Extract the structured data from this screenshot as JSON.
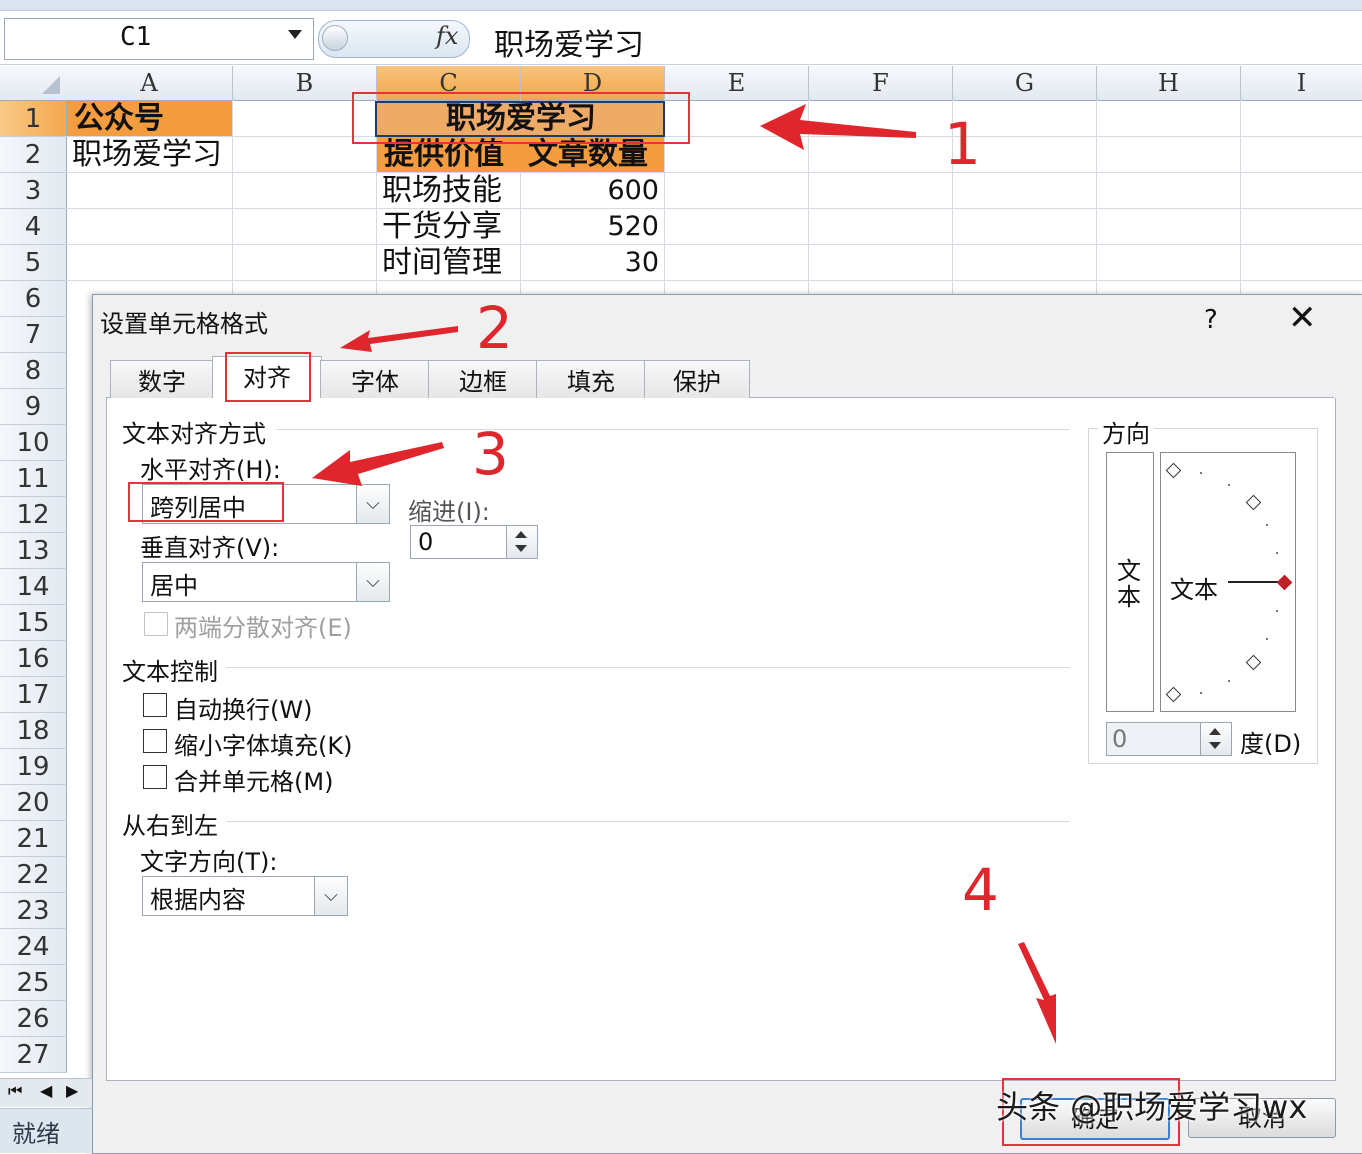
{
  "formula_bar": {
    "name_box": "C1",
    "fx_label": "fx",
    "formula": "职场爱学习"
  },
  "columns": [
    "A",
    "B",
    "C",
    "D",
    "E",
    "F",
    "G",
    "H",
    "I"
  ],
  "rows": [
    "1",
    "2",
    "3",
    "4",
    "5",
    "6",
    "7",
    "8",
    "9",
    "10",
    "11",
    "12",
    "13",
    "14",
    "15",
    "16",
    "17",
    "18",
    "19",
    "20",
    "21",
    "22",
    "23",
    "24",
    "25",
    "26",
    "27"
  ],
  "cells": {
    "A1": "公众号",
    "A2": "职场爱学习",
    "C1": "职场爱学习",
    "C2": "提供价值",
    "D2": "文章数量",
    "C3": "职场技能",
    "D3": "600",
    "C4": "干货分享",
    "D4": "520",
    "C5": "时间管理",
    "D5": "30"
  },
  "dialog": {
    "title": "设置单元格格式",
    "help": "?",
    "close": "✕",
    "tabs": [
      "数字",
      "对齐",
      "字体",
      "边框",
      "填充",
      "保护"
    ],
    "active_tab": "对齐",
    "text_alignment": {
      "heading": "文本对齐方式",
      "horizontal_label": "水平对齐(H):",
      "horizontal_value": "跨列居中",
      "indent_label": "缩进(I):",
      "indent_value": "0",
      "vertical_label": "垂直对齐(V):",
      "vertical_value": "居中",
      "distributed_label": "两端分散对齐(E)"
    },
    "text_control": {
      "heading": "文本控制",
      "wrap": "自动换行(W)",
      "shrink": "缩小字体填充(K)",
      "merge": "合并单元格(M)"
    },
    "rtl": {
      "heading": "从右到左",
      "direction_label": "文字方向(T):",
      "direction_value": "根据内容"
    },
    "orientation": {
      "heading": "方向",
      "vertical_text": "文本",
      "dial_text": "文本",
      "degrees_value": "0",
      "degrees_label": "度(D)"
    },
    "ok": "确定",
    "cancel": "取消"
  },
  "annotations": [
    "1",
    "2",
    "3",
    "4"
  ],
  "status": {
    "ready": "就绪",
    "nav_icons": [
      "first-sheet-icon",
      "prev-sheet-icon",
      "next-sheet-icon"
    ]
  },
  "watermark": "头条 @职场爱学习wx",
  "colors": {
    "selected_header": "#f3a64a",
    "header_fill": "#f49c40",
    "annotation_red": "#e0262d"
  }
}
